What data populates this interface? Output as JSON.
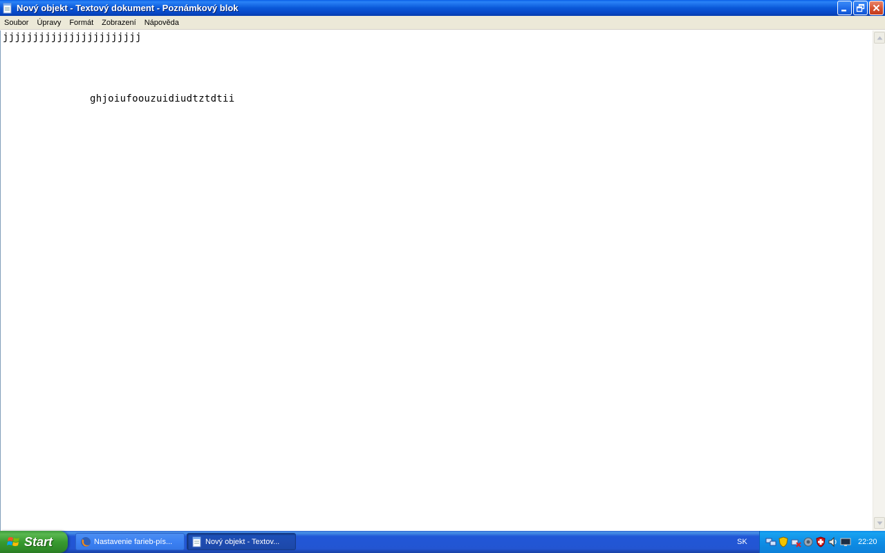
{
  "window": {
    "title": "Nový objekt - Textový dokument - Poznámkový blok",
    "app_icon": "notepad-icon",
    "buttons": [
      "minimize-icon",
      "restore-icon",
      "close-icon"
    ]
  },
  "menu": {
    "items": [
      "Soubor",
      "Úpravy",
      "Formát",
      "Zobrazení",
      "Nápověda"
    ]
  },
  "editor": {
    "lines": [
      "jjjjjjjjjjjjjjjjjjjjjjj",
      "ghjoiufoouzuidiudtztdtii"
    ]
  },
  "scrollbar": {
    "up_icon": "scroll-up-icon",
    "down_icon": "scroll-down-icon"
  },
  "taskbar": {
    "start_label": "Start",
    "tasks": [
      {
        "label": "Nastavenie farieb-pís...",
        "icon": "firefox-icon",
        "active": false
      },
      {
        "label": "Nový objekt - Textov...",
        "icon": "notepad-icon",
        "active": true
      }
    ],
    "language": "SK",
    "tray_icons": [
      "network-icon",
      "security-shield-icon",
      "wireless-disconnected-icon",
      "speaker-alt-icon",
      "antivirus-icon",
      "volume-icon",
      "display-icon"
    ],
    "clock": "22:20"
  },
  "colors": {
    "titlebar": "#0a58d8",
    "menubar": "#ece9d8",
    "taskbar": "#2355d2",
    "start": "#389a30",
    "tray": "#0f8ee6"
  }
}
